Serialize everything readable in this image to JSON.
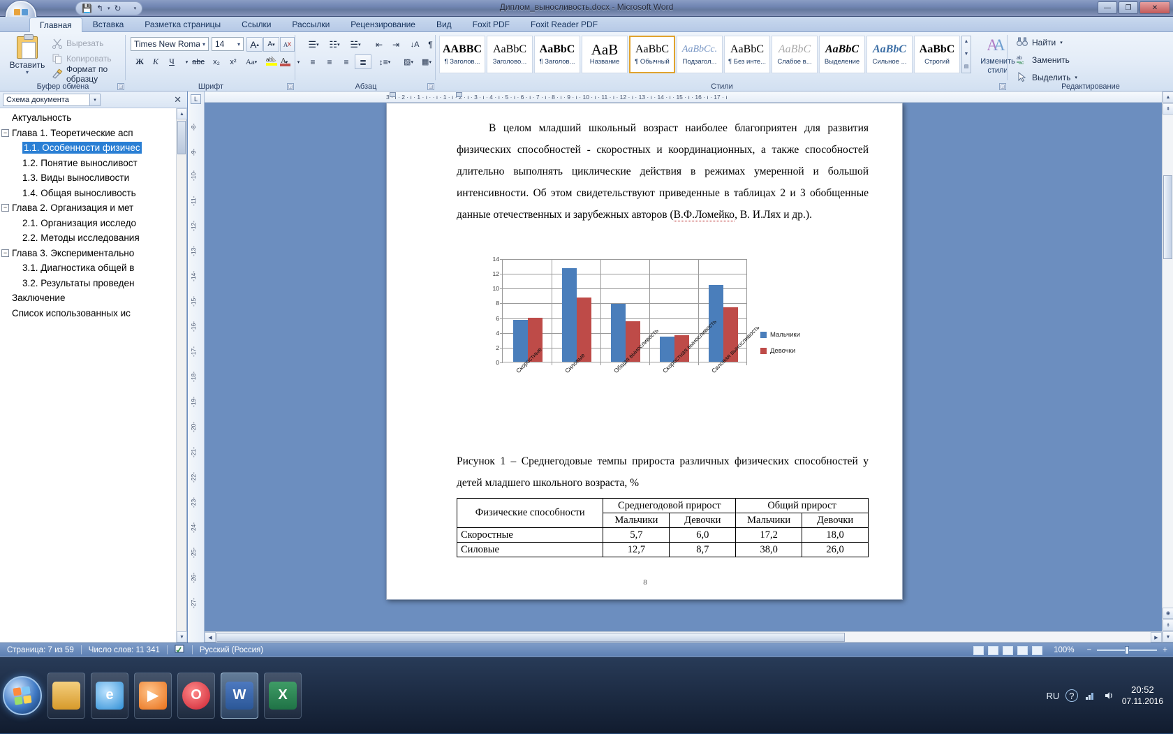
{
  "window": {
    "title": "Диплом_выносливость.docx - Microsoft Word",
    "minimize": "—",
    "maximize": "❐",
    "close": "✕"
  },
  "quick_access": {
    "save": "💾",
    "undo": "↰",
    "undo_more": "▾",
    "redo": "↻",
    "customize": "▾"
  },
  "ribbon": {
    "tabs": [
      {
        "label": "Главная",
        "active": true
      },
      {
        "label": "Вставка",
        "active": false
      },
      {
        "label": "Разметка страницы",
        "active": false
      },
      {
        "label": "Ссылки",
        "active": false
      },
      {
        "label": "Рассылки",
        "active": false
      },
      {
        "label": "Рецензирование",
        "active": false
      },
      {
        "label": "Вид",
        "active": false
      },
      {
        "label": "Foxit PDF",
        "active": false
      },
      {
        "label": "Foxit Reader PDF",
        "active": false
      }
    ],
    "groups": {
      "clipboard": {
        "name": "Буфер обмена",
        "paste": "Вставить",
        "paste_caret": "▾",
        "cut": "Вырезать",
        "copy": "Копировать",
        "format_painter": "Формат по образцу"
      },
      "font": {
        "name": "Шрифт",
        "font_family": "Times New Roman",
        "font_size": "14",
        "grow": "A",
        "shrink": "A",
        "bold": "Ж",
        "italic": "К",
        "underline": "Ч",
        "strike": "abc",
        "subscript": "x₂",
        "superscript": "x²",
        "case": "Aa",
        "highlight": "ab",
        "fontcolor": "A"
      },
      "paragraph": {
        "name": "Абзац",
        "bullets": "≔",
        "numbering": "≕",
        "multilevel": "≖",
        "decrease_indent": "⇤",
        "increase_indent": "⇥",
        "sort": "↓A",
        "show_marks": "¶",
        "align_left": "≡",
        "align_center": "≡",
        "align_right": "≡",
        "justify": "≡",
        "line_spacing": "↕",
        "shading": "▨",
        "borders": "▦"
      },
      "styles": {
        "name": "Стили",
        "change_styles": "Изменить стили",
        "change_styles_caret": "▾",
        "items": [
          {
            "preview": "AABBC",
            "name": "¶ Заголов...",
            "selected": false
          },
          {
            "preview": "AaBbC",
            "name": "Заголово...",
            "selected": false
          },
          {
            "preview": "AaBbC",
            "name": "¶ Заголов...",
            "selected": false
          },
          {
            "preview": "AaB",
            "name": "Название",
            "selected": false
          },
          {
            "preview": "AaBbC",
            "name": "¶ Обычный",
            "selected": true
          },
          {
            "preview": "AaBbCc.",
            "name": "Подзагол...",
            "selected": false
          },
          {
            "preview": "AaBbC",
            "name": "¶ Без инте...",
            "selected": false
          },
          {
            "preview": "AaBbC",
            "name": "Слабое в...",
            "selected": false
          },
          {
            "preview": "AaBbC",
            "name": "Выделение",
            "selected": false
          },
          {
            "preview": "AaBbC",
            "name": "Сильное ...",
            "selected": false
          },
          {
            "preview": "AaBbC",
            "name": "Строгий",
            "selected": false
          }
        ]
      },
      "editing": {
        "name": "Редактирование",
        "find": "Найти",
        "find_caret": "▾",
        "replace": "Заменить",
        "select": "Выделить",
        "select_caret": "▾"
      }
    }
  },
  "document_map": {
    "title": "Схема документа",
    "close": "✕",
    "items": [
      {
        "label": "Актуальность",
        "level": 0,
        "expandable": false,
        "selected": false
      },
      {
        "label": "Глава 1. Теоретические асп",
        "level": 0,
        "expandable": true,
        "selected": false
      },
      {
        "label": "1.1. Особенности физичес",
        "level": 1,
        "expandable": false,
        "selected": true
      },
      {
        "label": "1.2. Понятие выносливост",
        "level": 1,
        "expandable": false,
        "selected": false
      },
      {
        "label": "1.3. Виды выносливости",
        "level": 1,
        "expandable": false,
        "selected": false
      },
      {
        "label": "1.4. Общая выносливость",
        "level": 1,
        "expandable": false,
        "selected": false
      },
      {
        "label": "Глава 2. Организация и мет",
        "level": 0,
        "expandable": true,
        "selected": false
      },
      {
        "label": "2.1. Организация исследо",
        "level": 1,
        "expandable": false,
        "selected": false
      },
      {
        "label": "2.2. Методы исследования",
        "level": 1,
        "expandable": false,
        "selected": false
      },
      {
        "label": "Глава 3. Экспериментально",
        "level": 0,
        "expandable": true,
        "selected": false
      },
      {
        "label": "3.1. Диагностика общей в",
        "level": 1,
        "expandable": false,
        "selected": false
      },
      {
        "label": "3.2. Результаты проведен",
        "level": 1,
        "expandable": false,
        "selected": false
      },
      {
        "label": "Заключение",
        "level": 0,
        "expandable": false,
        "selected": false
      },
      {
        "label": "Список использованных ис",
        "level": 0,
        "expandable": false,
        "selected": false
      }
    ]
  },
  "rulers": {
    "vertical_marks": [
      "-8-",
      "-9-",
      "-10-",
      "-11-",
      "-12-",
      "-13-",
      "-14-",
      "-15-",
      "-16-",
      "-17-",
      "-18-",
      "-19-",
      "-20-",
      "-21-",
      "-22-",
      "-23-",
      "-24-",
      "-25-",
      "-26-",
      "-27-"
    ],
    "horizontal": "3 · ı · 2 · ı · 1 · ı ·  · ı · 1 · ı · 2 · ı · 3 · ı · 4 · ı · 5 · ı · 6 · ı · 7 · ı · 8 · ı · 9 · ı · 10 · ı · 11 · ı · 12 · ı · 13 · ı · 14 · ı · 15 · ı · 16 · ı · 17 · ı"
  },
  "document": {
    "paragraph": "В целом младший школьный возраст наиболее благоприятен для развития физических способностей - скоростных и координационных, а также способностей длительно выполнять циклические действия в режимах умеренной и большой интенсивности. Об этом свидетельствуют приведенные в таблицах 2 и 3 обобщенные данные отечественных и зарубежных авторов (",
    "paragraph_link": "В.Ф.Ломейко",
    "paragraph_tail": ", В. И.Лях и др.).",
    "figure_caption": "Рисунок 1 – Среднегодовые темпы прироста различных физических способностей у детей младшего школьного возраста, %",
    "page_number": "8"
  },
  "chart_data": {
    "type": "bar",
    "title": "",
    "xlabel": "",
    "ylabel": "",
    "ylim": [
      0,
      14
    ],
    "yticks": [
      0,
      2,
      4,
      6,
      8,
      10,
      12,
      14
    ],
    "grid": true,
    "legend_position": "right",
    "categories": [
      "Скоростные",
      "Силовые",
      "Общая выносливость",
      "Скоростная выносливость",
      "Силовая выносливость"
    ],
    "series": [
      {
        "name": "Мальчики",
        "color": "#4a7ebb",
        "values": [
          5.7,
          12.7,
          7.9,
          3.4,
          10.4
        ]
      },
      {
        "name": "Девочки",
        "color": "#be4b48",
        "values": [
          6.0,
          8.7,
          5.5,
          3.6,
          7.4
        ]
      }
    ]
  },
  "table": {
    "header_top": [
      "Физические способности",
      "Среднегодовой прирост",
      "Общий прирост"
    ],
    "header_sub": [
      "Мальчики",
      "Девочки",
      "Мальчики",
      "Девочки"
    ],
    "rows": [
      [
        "Скоростные",
        "5,7",
        "6,0",
        "17,2",
        "18,0"
      ],
      [
        "Силовые",
        "12,7",
        "8,7",
        "38,0",
        "26,0"
      ]
    ]
  },
  "status_bar": {
    "page": "Страница: 7 из 59",
    "words": "Число слов: 11 341",
    "proofing_icon": "spellcheck-icon",
    "language": "Русский (Россия)",
    "zoom": "100%",
    "zoom_out": "−",
    "zoom_in": "+"
  },
  "taskbar": {
    "start": "start-orb-icon",
    "items": [
      {
        "name": "explorer",
        "glyph": "📁",
        "bg": "#e8b457",
        "active": false
      },
      {
        "name": "internet-explorer",
        "glyph": "e",
        "bg": "#2f8fd6",
        "active": false
      },
      {
        "name": "media-player",
        "glyph": "▶",
        "bg": "#e8701a",
        "active": false
      },
      {
        "name": "opera",
        "glyph": "O",
        "bg": "#cc2030",
        "active": false
      },
      {
        "name": "word",
        "glyph": "W",
        "bg": "#2b5797",
        "active": true
      },
      {
        "name": "excel",
        "glyph": "X",
        "bg": "#1f7246",
        "active": false
      }
    ],
    "tray": {
      "language": "RU",
      "help": "?",
      "time": "20:52",
      "date": "07.11.2016"
    }
  },
  "colors": {
    "accent_blue": "#4a7ebb",
    "accent_red": "#be4b48",
    "selection": "#2a7fd4",
    "style_selected_border": "#e0a32e"
  }
}
